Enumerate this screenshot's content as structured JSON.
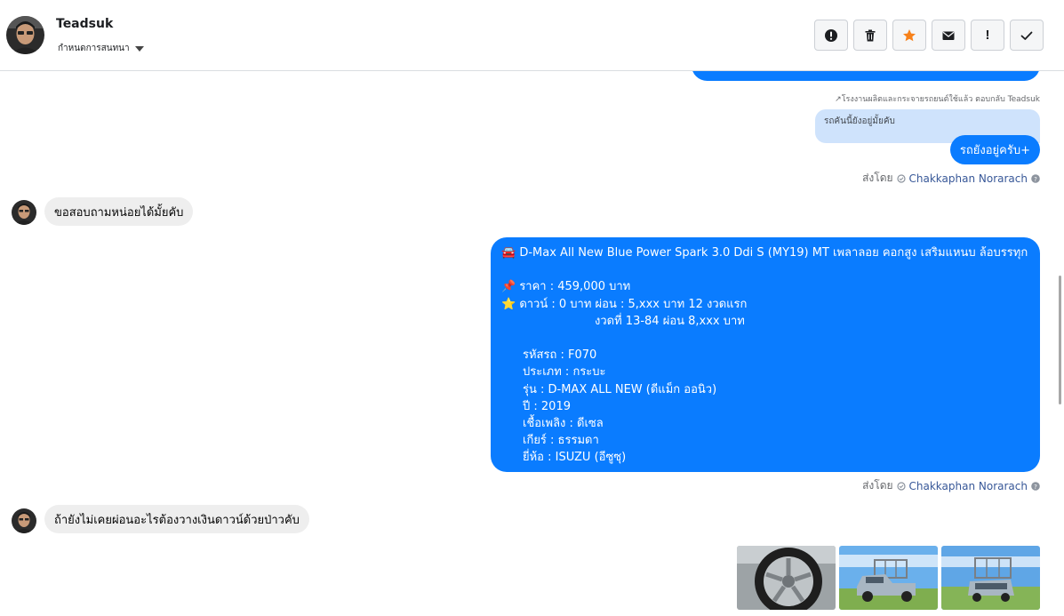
{
  "header": {
    "contact_name": "Teadsuk",
    "assign_label": "กำหนดการสนทนา",
    "actions": [
      {
        "icon": "alert-circle-icon",
        "name": "report-button"
      },
      {
        "icon": "trash-icon",
        "name": "delete-button"
      },
      {
        "icon": "star-icon",
        "name": "star-button"
      },
      {
        "icon": "envelope-icon",
        "name": "mark-unread-button"
      },
      {
        "icon": "exclamation-icon",
        "name": "spam-button"
      },
      {
        "icon": "check-icon",
        "name": "done-button"
      }
    ]
  },
  "thread": {
    "reply_note": "↗โรงงานผลิตและกระจายรถยนต์ใช้แล้ว ตอบกลับ Teadsuk",
    "quoted_text": "รถคันนี้ยังอยู่มั้ยคับ",
    "reply_text": "รถยังอยู่ครับ+",
    "sent_by_label": "ส่งโดย",
    "agent_name": "Chakkaphan Norarach",
    "customer_msg_1": "ขอสอบถามหน่อยได้มั้ยคับ",
    "listing": {
      "title": "🚘 D-Max All New Blue Power Spark 3.0 Ddi S (MY19) MT เพลาลอย คอกสูง เสริมแหนบ ล้อบรรทุก",
      "price": "📌 ราคา : 459,000 บาท",
      "down_payment": "⭐ ดาวน์ : 0 บาท ผ่อน : 5,xxx บาท 12 งวดแรก",
      "installments": "งวดที่ 13-84 ผ่อน 8,xxx บาท",
      "code": "รหัสรถ : F070",
      "type": "ประเภท : กระบะ",
      "model": "รุ่น : D-MAX ALL NEW (ดีแม็ก ออนิว)",
      "year": "ปี : 2019",
      "fuel": "เชื้อเพลิง : ดีเซล",
      "gear": "เกียร์ : ธรรมดา",
      "brand": "ยี่ห้อ : ISUZU (อีซูซุ)"
    },
    "customer_msg_2": "ถ้ายังไม่เคยผ่อนอะไรต้องวางเงินดาวน์ด้วยป่าวคับ"
  },
  "colors": {
    "agent_bubble": "#0a7cff",
    "customer_bubble": "#eeeeee",
    "quoted_bubble": "#cfe3fc",
    "star": "#f7811a"
  }
}
